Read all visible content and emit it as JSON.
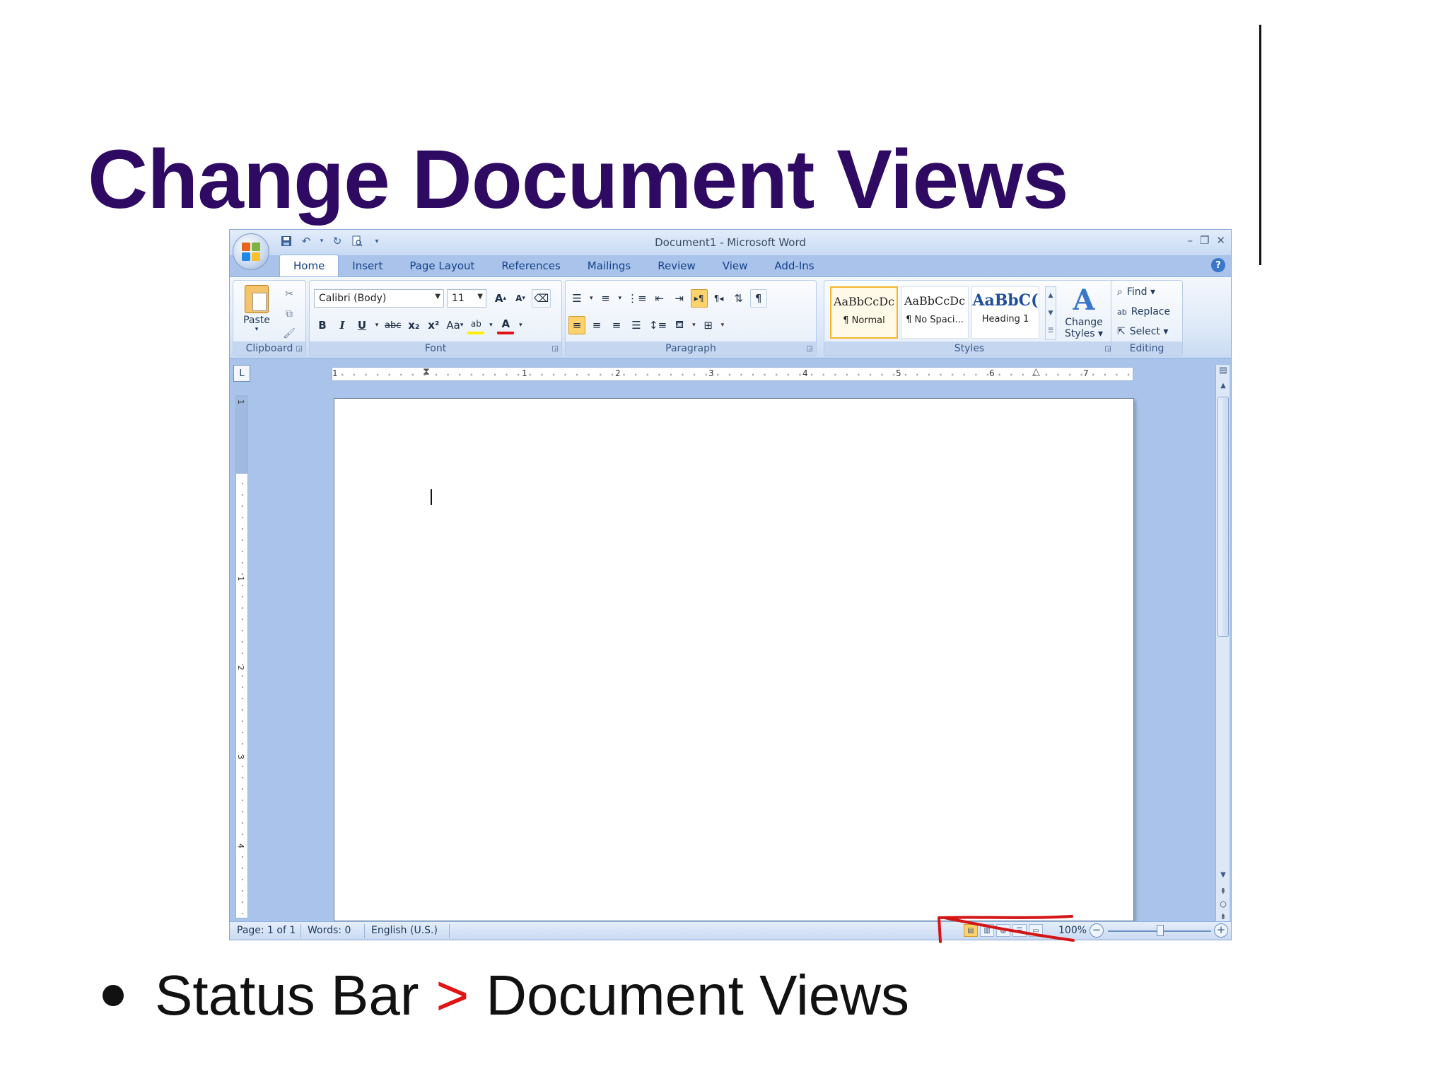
{
  "slide": {
    "title": "Change Document Views",
    "bullet": {
      "left": "Status Bar",
      "separator": ">",
      "right": "Document Views"
    }
  },
  "window": {
    "title": "Document1 - Microsoft Word",
    "controls": {
      "minimize": "–",
      "restore": "❐",
      "close": "✕"
    },
    "help": "?"
  },
  "quick_access": {
    "icons": [
      "save-icon",
      "undo-icon",
      "redo-icon",
      "print-preview-icon",
      "customize-icon"
    ]
  },
  "tabs": [
    {
      "label": "Home",
      "active": true
    },
    {
      "label": "Insert"
    },
    {
      "label": "Page Layout"
    },
    {
      "label": "References"
    },
    {
      "label": "Mailings"
    },
    {
      "label": "Review"
    },
    {
      "label": "View"
    },
    {
      "label": "Add-Ins"
    }
  ],
  "ribbon": {
    "clipboard": {
      "label": "Clipboard",
      "paste": "Paste"
    },
    "font": {
      "label": "Font",
      "name": "Calibri (Body)",
      "size": "11",
      "grow": "A",
      "shrink": "A",
      "bold": "B",
      "italic": "I",
      "underline": "U",
      "strike": "abc",
      "subscript": "x₂",
      "superscript": "x²",
      "change_case": "Aa",
      "highlight": "ab",
      "font_color": "A"
    },
    "paragraph": {
      "label": "Paragraph",
      "show_hide": "¶"
    },
    "styles": {
      "label": "Styles",
      "items": [
        {
          "sample": "AaBbCcDc",
          "name": "¶ Normal"
        },
        {
          "sample": "AaBbCcDc",
          "name": "¶ No Spaci..."
        },
        {
          "sample": "AaBbC(",
          "name": "Heading 1"
        }
      ],
      "change_styles": {
        "line1": "Change",
        "line2": "Styles ▾"
      }
    },
    "editing": {
      "label": "Editing",
      "find": "Find ▾",
      "replace": "Replace",
      "select": "Select ▾"
    }
  },
  "ruler": {
    "h_numbers": [
      "1",
      "1",
      "2",
      "3",
      "4",
      "5",
      "6",
      "7"
    ],
    "v_numbers": [
      "1",
      "1",
      "2",
      "3",
      "4"
    ]
  },
  "statusbar": {
    "page": "Page: 1 of 1",
    "words": "Words: 0",
    "language": "English (U.S.)",
    "zoom": "100%",
    "zoom_level_percent": 100
  },
  "colors": {
    "title": "#2f0a63",
    "separator": "#e01414",
    "annotation": "#d41515"
  }
}
